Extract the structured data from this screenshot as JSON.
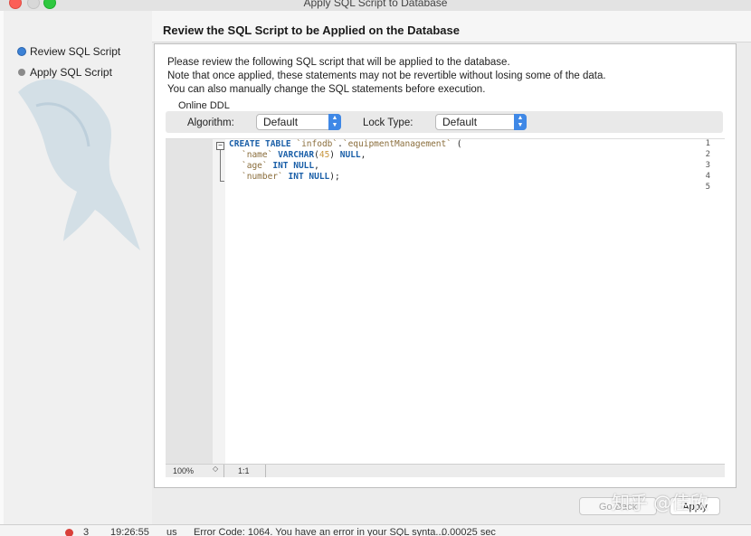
{
  "window": {
    "title": "Apply SQL Script to Database"
  },
  "sidebar": {
    "steps": [
      {
        "label": "Review SQL Script"
      },
      {
        "label": "Apply SQL Script"
      }
    ]
  },
  "page": {
    "heading": "Review the SQL Script to be Applied on the Database",
    "description": [
      "Please review the following SQL script that will be applied to the database.",
      "Note that once applied, these statements may not be revertible without losing some of the data.",
      "You can also manually change the SQL statements before execution."
    ]
  },
  "online_ddl": {
    "label": "Online DDL",
    "algorithm_label": "Algorithm:",
    "algorithm_value": "Default",
    "lock_label": "Lock Type:",
    "lock_value": "Default"
  },
  "editor": {
    "line_numbers": [
      "1",
      "2",
      "3",
      "4",
      "5"
    ],
    "lines": [
      [
        [
          "kw",
          "CREATE TABLE "
        ],
        [
          "id",
          "`infodb`"
        ],
        [
          "pl",
          "."
        ],
        [
          "id",
          "`equipmentManagement`"
        ],
        [
          "pl",
          " ("
        ]
      ],
      [
        [
          "id",
          "`name`"
        ],
        [
          "pl",
          " "
        ],
        [
          "kw",
          "VARCHAR"
        ],
        [
          "pl",
          "("
        ],
        [
          "num",
          "45"
        ],
        [
          "pl",
          ") "
        ],
        [
          "kw",
          "NULL"
        ],
        [
          "pl",
          ","
        ]
      ],
      [
        [
          "id",
          "`age`"
        ],
        [
          "pl",
          " "
        ],
        [
          "kw",
          "INT NULL"
        ],
        [
          "pl",
          ","
        ]
      ],
      [
        [
          "id",
          "`number`"
        ],
        [
          "pl",
          " "
        ],
        [
          "kw",
          "INT NULL"
        ],
        [
          "pl",
          ");"
        ]
      ],
      []
    ],
    "zoom": "100%",
    "cursor_pos": "1:1"
  },
  "buttons": {
    "back": "Go Back",
    "apply": "Apply"
  },
  "watermark": "知乎 @佳欣",
  "background_log": {
    "num": "3",
    "time": "19:26:55",
    "action": "us",
    "message": "Error Code: 1064. You have an error in your SQL synta...",
    "duration": "0.00025 sec"
  },
  "colors": {
    "keyword": "#1a5fa8",
    "identifier": "#8a6d3b",
    "number": "#c8963e",
    "accent": "#3f88e6"
  }
}
